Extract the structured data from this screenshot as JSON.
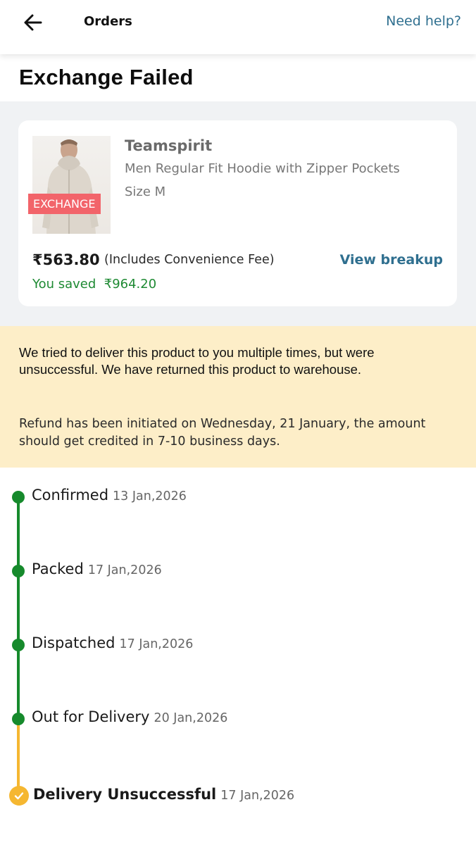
{
  "header": {
    "title": "Orders",
    "help_label": "Need help?"
  },
  "page_title": "Exchange Failed",
  "product": {
    "brand": "Teamspirit",
    "name": "Men Regular Fit Hoodie with Zipper Pockets",
    "size": "Size M",
    "badge": "EXCHANGE",
    "price": "₹563.80",
    "price_note": "(Includes Convenience Fee)",
    "view_breakup": "View breakup",
    "saved": "You saved  ₹964.20"
  },
  "notice": {
    "message": "We tried to deliver this product to you multiple times, but were unsuccessful. We have returned this product to warehouse.",
    "refund": "Refund has been initiated on Wednesday, 21 January, the amount should get credited in 7-10 business days."
  },
  "timeline": [
    {
      "label": "Confirmed",
      "date": "13 Jan,2026"
    },
    {
      "label": "Packed",
      "date": "17 Jan,2026"
    },
    {
      "label": "Dispatched",
      "date": "17 Jan,2026"
    },
    {
      "label": "Out for Delivery",
      "date": "20 Jan,2026"
    },
    {
      "label": "Delivery Unsuccessful",
      "date": "17 Jan,2026"
    }
  ],
  "colors": {
    "link": "#2f6f8f",
    "success_green": "#168a2c",
    "warning_yellow": "#f5b731",
    "notice_bg": "#fdeec8",
    "badge_red": "#f2646a"
  },
  "icons": [
    "back-arrow-icon",
    "check-icon"
  ]
}
